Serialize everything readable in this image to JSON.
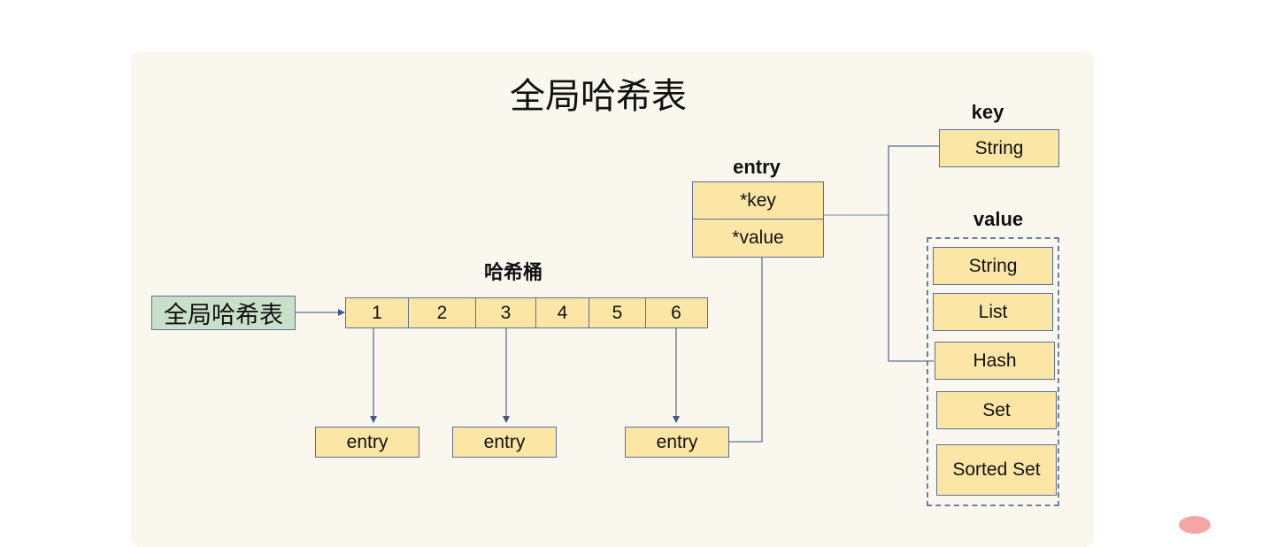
{
  "diagram": {
    "title": "全局哈希表",
    "global_table_box": "全局哈希表",
    "bucket_label": "哈希桶",
    "buckets": [
      "1",
      "2",
      "3",
      "4",
      "5",
      "6"
    ],
    "entries": [
      "entry",
      "entry",
      "entry"
    ],
    "entry_struct": {
      "label": "entry",
      "fields": [
        "*key",
        "*value"
      ]
    },
    "key": {
      "label": "key",
      "type": "String"
    },
    "value": {
      "label": "value",
      "types": [
        "String",
        "List",
        "Hash",
        "Set",
        "Sorted Set"
      ]
    },
    "colors": {
      "panel_bg": "#faf8ee",
      "box_fill": "#fbe6a5",
      "global_box_fill": "#c9e0c8",
      "stroke": "#5b6f96"
    }
  }
}
